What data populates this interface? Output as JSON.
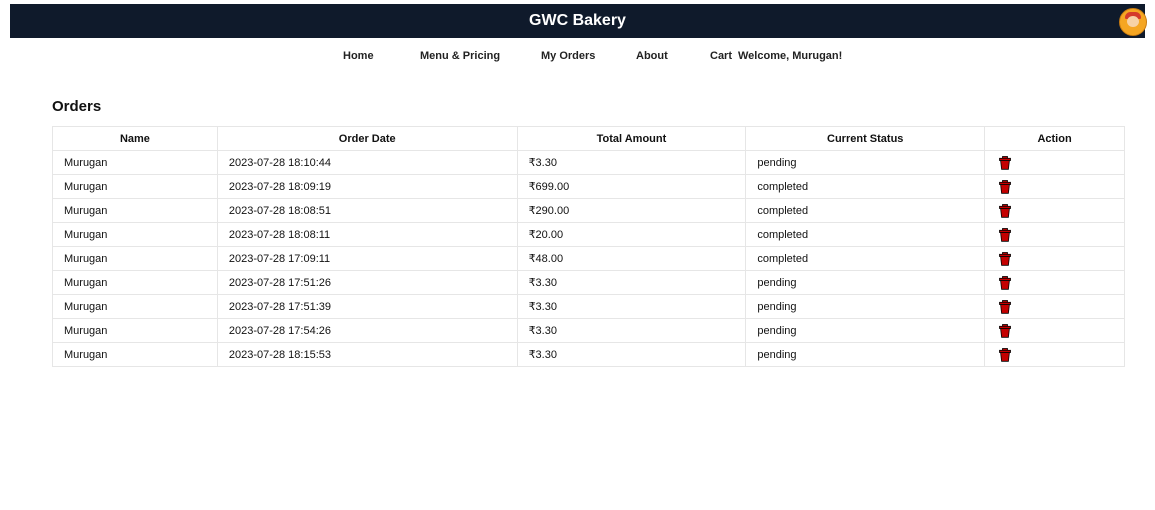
{
  "header": {
    "title": "GWC Bakery",
    "avatar_icon": "user-avatar-icon"
  },
  "nav": {
    "items": [
      {
        "label": "Home"
      },
      {
        "label": "Menu & Pricing"
      },
      {
        "label": "My Orders"
      },
      {
        "label": "About"
      },
      {
        "label": "Cart"
      }
    ],
    "welcome": "Welcome, Murugan!"
  },
  "orders": {
    "title": "Orders",
    "columns": [
      "Name",
      "Order Date",
      "Total Amount",
      "Current Status",
      "Action"
    ],
    "rows": [
      {
        "name": "Murugan",
        "date": "2023-07-28 18:10:44",
        "amount": "₹3.30",
        "status": "pending"
      },
      {
        "name": "Murugan",
        "date": "2023-07-28 18:09:19",
        "amount": "₹699.00",
        "status": "completed"
      },
      {
        "name": "Murugan",
        "date": "2023-07-28 18:08:51",
        "amount": "₹290.00",
        "status": "completed"
      },
      {
        "name": "Murugan",
        "date": "2023-07-28 18:08:11",
        "amount": "₹20.00",
        "status": "completed"
      },
      {
        "name": "Murugan",
        "date": "2023-07-28 17:09:11",
        "amount": "₹48.00",
        "status": "completed"
      },
      {
        "name": "Murugan",
        "date": "2023-07-28 17:51:26",
        "amount": "₹3.30",
        "status": "pending"
      },
      {
        "name": "Murugan",
        "date": "2023-07-28 17:51:39",
        "amount": "₹3.30",
        "status": "pending"
      },
      {
        "name": "Murugan",
        "date": "2023-07-28 17:54:26",
        "amount": "₹3.30",
        "status": "pending"
      },
      {
        "name": "Murugan",
        "date": "2023-07-28 18:15:53",
        "amount": "₹3.30",
        "status": "pending"
      }
    ],
    "action_icon": "trash-icon"
  },
  "colors": {
    "header_bg": "#0f1a2b",
    "delete": "#c40000",
    "avatar": "#f5a623"
  }
}
